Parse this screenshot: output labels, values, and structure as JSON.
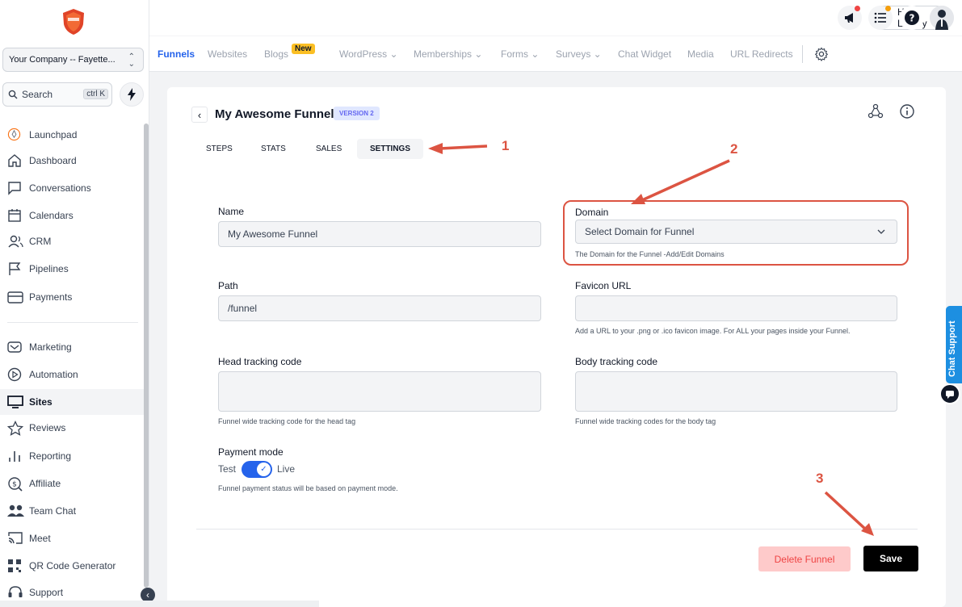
{
  "sidebar": {
    "company": "Your Company -- Fayette...",
    "search_placeholder": "Search",
    "search_shortcut": "ctrl K",
    "items": [
      {
        "label": "Launchpad",
        "icon": "rocket-icon"
      },
      {
        "label": "Dashboard",
        "icon": "home-icon"
      },
      {
        "label": "Conversations",
        "icon": "chat-icon"
      },
      {
        "label": "Calendars",
        "icon": "calendar-icon"
      },
      {
        "label": "CRM",
        "icon": "users-icon"
      },
      {
        "label": "Pipelines",
        "icon": "flag-icon"
      },
      {
        "label": "Payments",
        "icon": "card-icon"
      },
      {
        "label": "Marketing",
        "icon": "mail-icon"
      },
      {
        "label": "Automation",
        "icon": "play-icon"
      },
      {
        "label": "Sites",
        "icon": "monitor-icon"
      },
      {
        "label": "Reviews",
        "icon": "star-icon"
      },
      {
        "label": "Reporting",
        "icon": "bars-icon"
      },
      {
        "label": "Affiliate",
        "icon": "dollar-icon"
      },
      {
        "label": "Team Chat",
        "icon": "team-icon"
      },
      {
        "label": "Meet",
        "icon": "cast-icon"
      },
      {
        "label": "QR Code Generator",
        "icon": "qr-icon"
      },
      {
        "label": "Support",
        "icon": "headset-icon"
      }
    ]
  },
  "topbar": {
    "help_label": "Help Library",
    "help_q": "?"
  },
  "tabs": {
    "items": [
      {
        "label": "Funnels"
      },
      {
        "label": "Websites"
      },
      {
        "label": "Blogs"
      },
      {
        "label": "WordPress ⌄"
      },
      {
        "label": "Memberships ⌄"
      },
      {
        "label": "Forms ⌄"
      },
      {
        "label": "Surveys ⌄"
      },
      {
        "label": "Chat Widget"
      },
      {
        "label": "Media"
      },
      {
        "label": "URL Redirects"
      }
    ],
    "new_badge": "New"
  },
  "funnel": {
    "title": "My Awesome Funnel",
    "version": "VERSION 2",
    "tabs": [
      "STEPS",
      "STATS",
      "SALES",
      "SETTINGS"
    ]
  },
  "form": {
    "name_label": "Name",
    "name_value": "My Awesome Funnel",
    "domain_label": "Domain",
    "domain_value": "Select Domain for Funnel",
    "domain_hint": "The Domain for the Funnel -Add/Edit Domains",
    "path_label": "Path",
    "path_value": "/funnel",
    "favicon_label": "Favicon URL",
    "favicon_hint": "Add a URL to your .png or .ico favicon image. For ALL your pages inside your Funnel.",
    "head_label": "Head tracking code",
    "head_hint": "Funnel wide tracking code for the head tag",
    "body_label": "Body tracking code",
    "body_hint": "Funnel wide tracking codes for the body tag",
    "payment_label": "Payment mode",
    "payment_test": "Test",
    "payment_live": "Live",
    "payment_hint": "Funnel payment status will be based on payment mode.",
    "delete_label": "Delete Funnel",
    "save_label": "Save"
  },
  "annotations": {
    "one": "1",
    "two": "2",
    "three": "3"
  },
  "chat_support": "Chat Support",
  "colors": {
    "accent": "#2563eb",
    "annotation": "#dc5442",
    "danger_bg": "#fecaca"
  }
}
